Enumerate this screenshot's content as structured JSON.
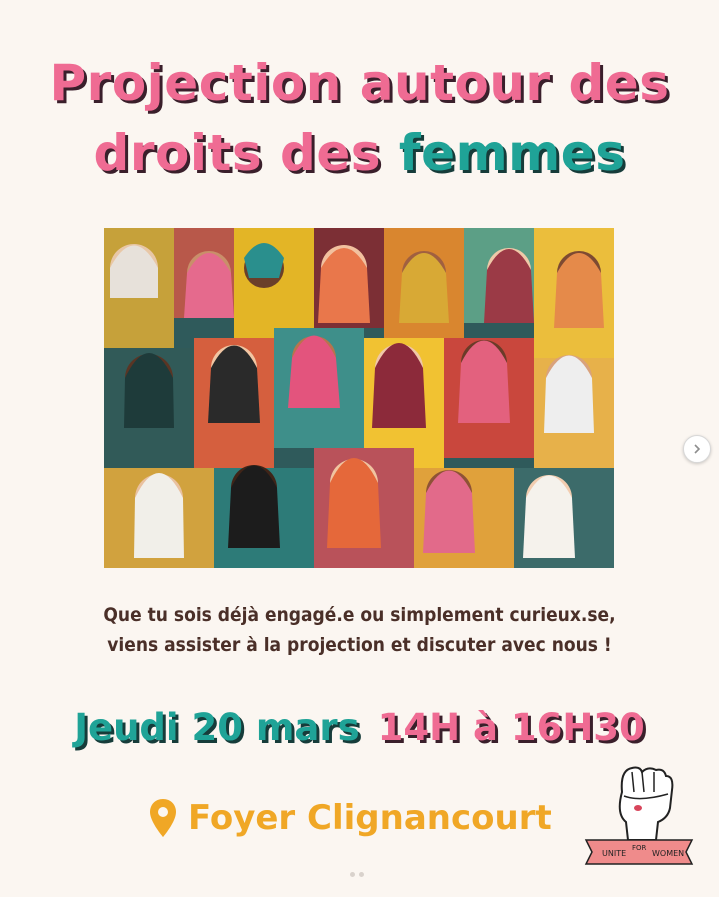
{
  "title": {
    "line1": "Projection autour des",
    "line2_part1": "droits des ",
    "line2_part2": "femmes"
  },
  "description": {
    "line1": "Que tu sois déjà engagé.e ou simplement curieux.se,",
    "line2": "viens assister à la projection et discuter avec nous !"
  },
  "event": {
    "date": "Jeudi 20 mars",
    "time": "14H à 16H30"
  },
  "location": {
    "name": "Foyer Clignancourt",
    "icon": "location-pin-icon"
  },
  "logo": {
    "left": "UNITE",
    "middle": "FOR",
    "right": "WOMEN"
  },
  "colors": {
    "pink": "#ef6b93",
    "teal": "#1fa397",
    "orange": "#f0a726",
    "background": "#fbf6f1",
    "text_brown": "#4a2f28"
  }
}
